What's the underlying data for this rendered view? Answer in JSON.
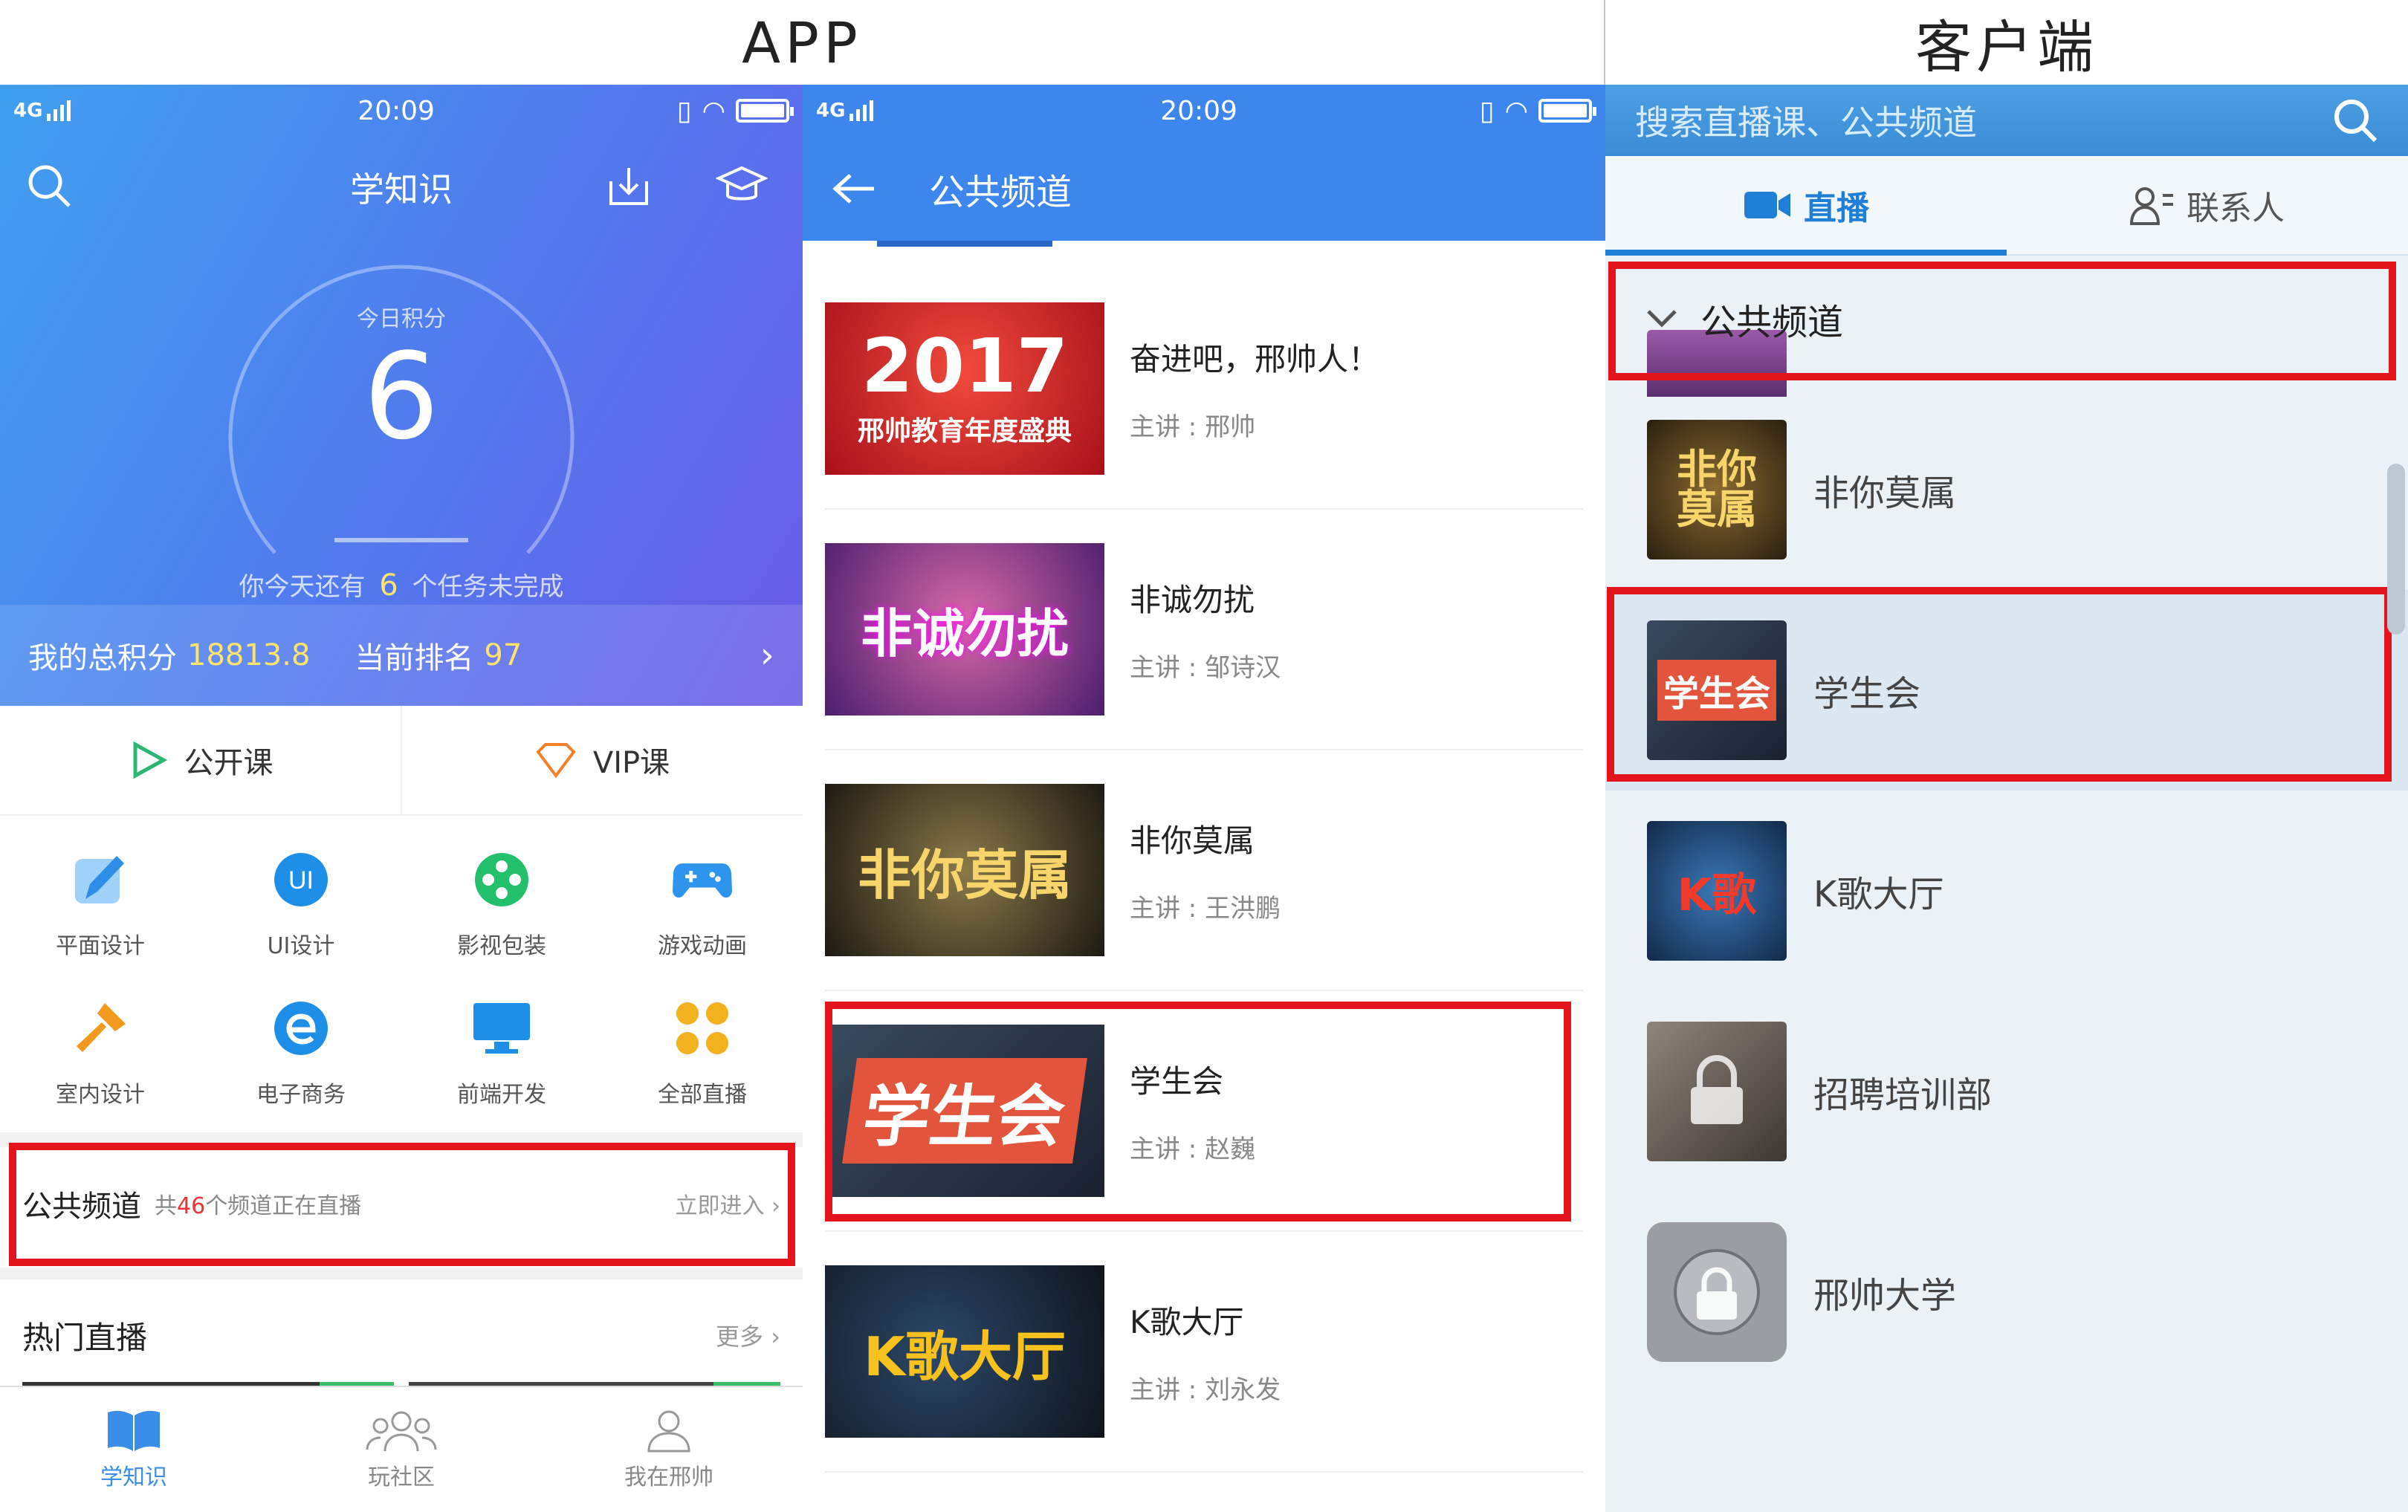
{
  "headers": {
    "app": "APP",
    "client": "客户端"
  },
  "status": {
    "network": "4G",
    "time": "20:09"
  },
  "app_home": {
    "title": "学知识",
    "gauge_label": "今日积分",
    "today_score": "6",
    "task_prefix": "你今天还有",
    "task_count": "6",
    "task_suffix": "个任务未完成",
    "total_label": "我的总积分",
    "total_value": "18813.8",
    "rank_label": "当前排名",
    "rank_value": "97",
    "course_tabs": [
      "公开课",
      "VIP课"
    ],
    "categories": [
      {
        "label": "平面设计",
        "icon": "brush-icon",
        "color": "#3aa0ee"
      },
      {
        "label": "UI设计",
        "icon": "ui-icon",
        "color": "#1e8fe8"
      },
      {
        "label": "影视包装",
        "icon": "film-reel-icon",
        "color": "#22c06a"
      },
      {
        "label": "游戏动画",
        "icon": "gamepad-icon",
        "color": "#2d95ee"
      },
      {
        "label": "室内设计",
        "icon": "flashlight-icon",
        "color": "#f29a1d"
      },
      {
        "label": "电子商务",
        "icon": "ecommerce-icon",
        "color": "#1e8fe8"
      },
      {
        "label": "前端开发",
        "icon": "monitor-icon",
        "color": "#1e8fe8"
      },
      {
        "label": "全部直播",
        "icon": "all-live-icon",
        "color": "#f2b21d"
      }
    ],
    "public_channel": {
      "label": "公共频道",
      "count_prefix": "共",
      "count": "46",
      "count_suffix": "个频道正在直播",
      "enter": "立即进入 ›"
    },
    "hot_live": {
      "label": "热门直播",
      "more": "更多 ›"
    },
    "bottom_nav": [
      "学知识",
      "玩社区",
      "我在邢帅"
    ]
  },
  "app_channels": {
    "title": "公共频道",
    "items": [
      {
        "title": "奋进吧，邢帅人！",
        "speaker": "主讲 : 邢帅",
        "thumb_text": "2017",
        "thumb_sub": "邢帅教育年度盛典",
        "bg": "#c8202a"
      },
      {
        "title": "非诚勿扰",
        "speaker": "主讲 : 邹诗汉",
        "thumb_text": "非诚勿扰",
        "thumb_sub": "",
        "bg": "#7a3a8e"
      },
      {
        "title": "非你莫属",
        "speaker": "主讲 : 王洪鹏",
        "thumb_text": "非你莫属",
        "thumb_sub": "",
        "bg": "#2e2a22"
      },
      {
        "title": "学生会",
        "speaker": "主讲 : 赵巍",
        "thumb_text": "学生会",
        "thumb_sub": "",
        "bg": "#26303e"
      },
      {
        "title": "K歌大厅",
        "speaker": "主讲 : 刘永发",
        "thumb_text": "K歌大厅",
        "thumb_sub": "",
        "bg": "#1c2634"
      }
    ]
  },
  "client": {
    "search_placeholder": "搜索直播课、公共频道",
    "tabs": [
      "直播",
      "联系人"
    ],
    "group_label": "公共频道",
    "items": [
      {
        "name": "非你莫属",
        "thumb_text": "非你莫属",
        "bg": "#3a2e1c"
      },
      {
        "name": "学生会",
        "thumb_text": "学生会",
        "bg": "#2a3444"
      },
      {
        "name": "K歌大厅",
        "thumb_text": "K歌",
        "bg": "#1e4c7c"
      },
      {
        "name": "招聘培训部",
        "thumb_text": "",
        "bg": "#6b6258"
      },
      {
        "name": "邢帅大学",
        "thumb_text": "",
        "bg": "#8a8e92"
      }
    ]
  }
}
